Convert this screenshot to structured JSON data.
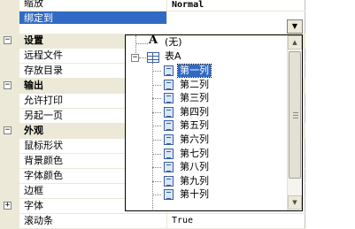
{
  "rows": {
    "suofang": {
      "name": "缩放",
      "value": "Normal"
    },
    "bangdingdao": {
      "name": "绑定到",
      "value": ""
    },
    "cat_settings": {
      "expander": "⊟",
      "name": "设置"
    },
    "remote_file": {
      "name": "远程文件",
      "value": ""
    },
    "save_dir": {
      "name": "存放目录",
      "value": ""
    },
    "cat_output": {
      "expander": "⊟",
      "name": "输出"
    },
    "allow_print": {
      "name": "允许打印",
      "value": ""
    },
    "new_page": {
      "name": "另起一页",
      "value": ""
    },
    "cat_appearance": {
      "expander": "⊟",
      "name": "外观"
    },
    "cursor_shape": {
      "name": "鼠标形状",
      "value": ""
    },
    "bg_color": {
      "name": "背景颜色",
      "value": ""
    },
    "font_color": {
      "name": "字体颜色",
      "value": ""
    },
    "border": {
      "name": "边框",
      "value": ""
    },
    "font": {
      "expander": "⊞",
      "name": "字体",
      "value": ""
    },
    "scrollbar": {
      "name": "滚动条",
      "value": "True"
    }
  },
  "dropdown": {
    "none_item": {
      "glyph": "A",
      "label": "(无)"
    },
    "table": {
      "expander": "⊟",
      "label": "表A"
    },
    "columns": [
      "第一列",
      "第二列",
      "第三列",
      "第四列",
      "第五列",
      "第六列",
      "第七列",
      "第八列",
      "第九列",
      "第十列"
    ],
    "selected_index": 0
  },
  "combo_arrow": "▼",
  "scroll_up": "▲",
  "scroll_down": "▼"
}
